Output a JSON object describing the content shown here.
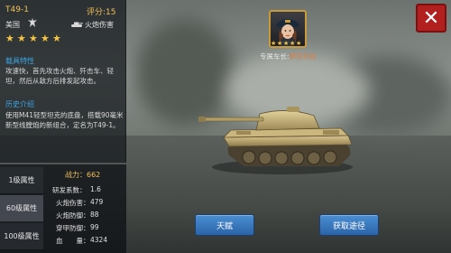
{
  "tank": {
    "id": "T49-1",
    "rating_label": "评分:",
    "rating_value": "15",
    "nation": "美国",
    "nation_icon": "eagle-icon",
    "type_icon": "tank-silhouette-icon",
    "type_label": "火炮伤害",
    "stars": 5
  },
  "section1": {
    "title": "载具特性",
    "text": "攻速快，首先攻击火炮、歼击车、轻坦，然后从敌方后排发起攻击。"
  },
  "section2": {
    "title": "历史介绍",
    "text": "使用M41轻型坦克的底盘，搭载90毫米新型线膛炮的新组合，定名为T49-1。"
  },
  "attributes": {
    "tabs": [
      "1级属性",
      "60级属性",
      "100级属性"
    ],
    "active_tab": 1,
    "power_label": "战力：",
    "power_value": "662",
    "stats": [
      {
        "label": "研发系数：",
        "value": "1.6"
      },
      {
        "label": "火炮伤害：",
        "value": "479"
      },
      {
        "label": "火炮防御：",
        "value": "88"
      },
      {
        "label": "穿甲防御：",
        "value": "99"
      },
      {
        "label": "血　　量：",
        "value": "4324"
      }
    ]
  },
  "commander": {
    "label": "专属车长:",
    "name": "伊莎贝拉",
    "stars": 5,
    "avatar_icon": "commander-portrait"
  },
  "buttons": {
    "talent": "天赋",
    "obtain": "获取途径",
    "close_icon": "close-icon"
  },
  "colors": {
    "accent_gold": "#f0c15a",
    "section_blue": "#3aa6e8",
    "button_blue": "#2b63a8",
    "close_red": "#b11f1f"
  }
}
